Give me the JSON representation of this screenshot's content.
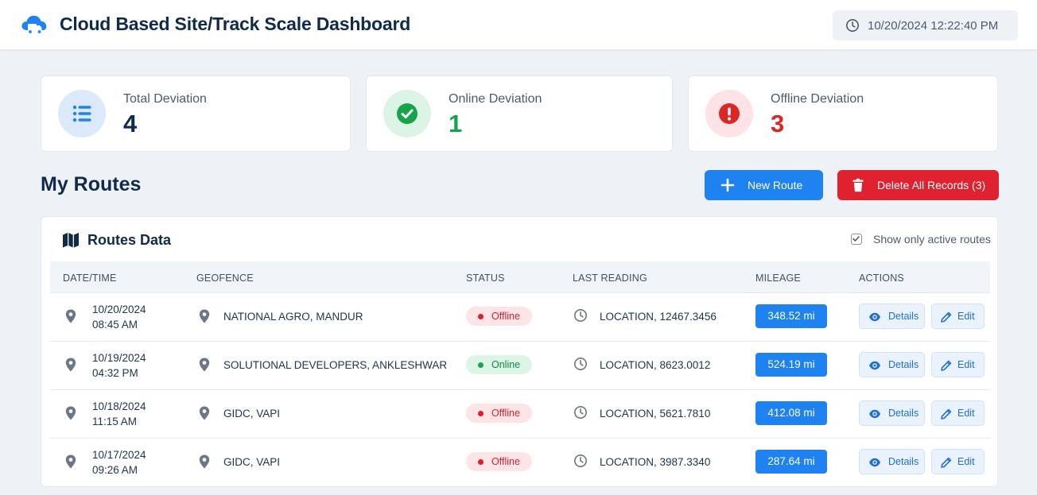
{
  "header": {
    "title": "Cloud Based Site/Track Scale Dashboard",
    "datetime": "10/20/2024 12:22:40 PM"
  },
  "stats": [
    {
      "label": "Total Deviation",
      "value": "4",
      "color": "#0f2a4a",
      "icon": "list-icon",
      "bg": "#dbe9fb"
    },
    {
      "label": "Online Deviation",
      "value": "1",
      "color": "#16a34a",
      "icon": "check-circle-icon",
      "bg": "#dcf4e5"
    },
    {
      "label": "Offline Deviation",
      "value": "3",
      "color": "#dc2626",
      "icon": "alert-circle-icon",
      "bg": "#fde3e5"
    }
  ],
  "routes": {
    "title": "My Routes",
    "new_route_label": "New Route",
    "delete_all_label": "Delete All Records (3)"
  },
  "panel": {
    "title": "Routes Data",
    "toggle_label": "Show only active routes",
    "toggle_checked": true
  },
  "table": {
    "headers": [
      "DATE/TIME",
      "GEOFENCE",
      "STATUS",
      "LAST READING",
      "MILEAGE",
      "ACTIONS"
    ],
    "details_label": "Details",
    "edit_label": "Edit",
    "rows": [
      {
        "date": "10/20/2024",
        "time": "08:45 AM",
        "geofence": "NATIONAL AGRO, MANDUR",
        "status": "Offline",
        "reading": "LOCATION, 12467.3456",
        "mileage": "348.52 mi"
      },
      {
        "date": "10/19/2024",
        "time": "04:32 PM",
        "geofence": "SOLUTIONAL DEVELOPERS, ANKLESHWAR",
        "status": "Online",
        "reading": "LOCATION, 8623.0012",
        "mileage": "524.19 mi"
      },
      {
        "date": "10/18/2024",
        "time": "11:15 AM",
        "geofence": "GIDC, VAPI",
        "status": "Offline",
        "reading": "LOCATION, 5621.7810",
        "mileage": "412.08 mi"
      },
      {
        "date": "10/17/2024",
        "time": "09:26 AM",
        "geofence": "GIDC, VAPI",
        "status": "Offline",
        "reading": "LOCATION, 3987.3340",
        "mileage": "287.64 mi"
      }
    ]
  },
  "colors": {
    "primary": "#1e82f0",
    "danger": "#e0212f",
    "online": "#16a34a",
    "offline": "#dc2626"
  }
}
